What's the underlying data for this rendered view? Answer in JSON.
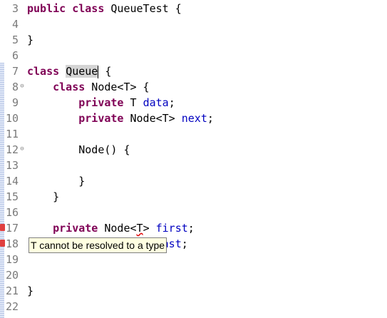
{
  "editor": {
    "lines": [
      {
        "num": "3",
        "segments": [
          {
            "t": "public",
            "c": "kw"
          },
          {
            "t": " "
          },
          {
            "t": "class",
            "c": "kw"
          },
          {
            "t": " QueueTest {"
          }
        ]
      },
      {
        "num": "4",
        "segments": []
      },
      {
        "num": "5",
        "segments": [
          {
            "t": "}"
          }
        ]
      },
      {
        "num": "6",
        "segments": []
      },
      {
        "num": "7",
        "segments": [
          {
            "t": "class",
            "c": "kw"
          },
          {
            "t": " "
          },
          {
            "t": "Queue",
            "c": "hl"
          },
          {
            "caret": true
          },
          {
            "t": " {"
          }
        ]
      },
      {
        "num": "8",
        "fold": true,
        "segments": [
          {
            "t": "    "
          },
          {
            "t": "class",
            "c": "kw"
          },
          {
            "t": " Node<T> {"
          }
        ]
      },
      {
        "num": "9",
        "segments": [
          {
            "t": "        "
          },
          {
            "t": "private",
            "c": "kw"
          },
          {
            "t": " T "
          },
          {
            "t": "data",
            "c": "fld"
          },
          {
            "t": ";"
          }
        ]
      },
      {
        "num": "10",
        "segments": [
          {
            "t": "        "
          },
          {
            "t": "private",
            "c": "kw"
          },
          {
            "t": " Node<T> "
          },
          {
            "t": "next",
            "c": "fld"
          },
          {
            "t": ";"
          }
        ]
      },
      {
        "num": "11",
        "segments": []
      },
      {
        "num": "12",
        "fold": true,
        "segments": [
          {
            "t": "        Node() {"
          }
        ]
      },
      {
        "num": "13",
        "segments": []
      },
      {
        "num": "14",
        "segments": [
          {
            "t": "        }"
          }
        ]
      },
      {
        "num": "15",
        "segments": [
          {
            "t": "    }"
          }
        ]
      },
      {
        "num": "16",
        "segments": []
      },
      {
        "num": "17",
        "error": true,
        "segments": [
          {
            "t": "    "
          },
          {
            "t": "private",
            "c": "kw"
          },
          {
            "t": " Node<"
          },
          {
            "t": "T",
            "c": "squig"
          },
          {
            "t": "> "
          },
          {
            "t": "first",
            "c": "fld"
          },
          {
            "t": ";"
          }
        ]
      },
      {
        "num": "18",
        "error": true,
        "segments": [
          {
            "t": "    "
          },
          {
            "t": "private",
            "c": "kw"
          },
          {
            "t": " Node<T> "
          },
          {
            "t": "last",
            "c": "fld"
          },
          {
            "t": ";"
          }
        ]
      },
      {
        "num": "19",
        "segments": []
      },
      {
        "num": "20",
        "segments": []
      },
      {
        "num": "21",
        "segments": [
          {
            "t": "}"
          }
        ]
      },
      {
        "num": "22",
        "segments": []
      }
    ]
  },
  "tooltip": {
    "text": "T cannot be resolved to a type"
  },
  "icons": {
    "fold": "fold-collapse-icon",
    "error": "error-marker-icon"
  }
}
